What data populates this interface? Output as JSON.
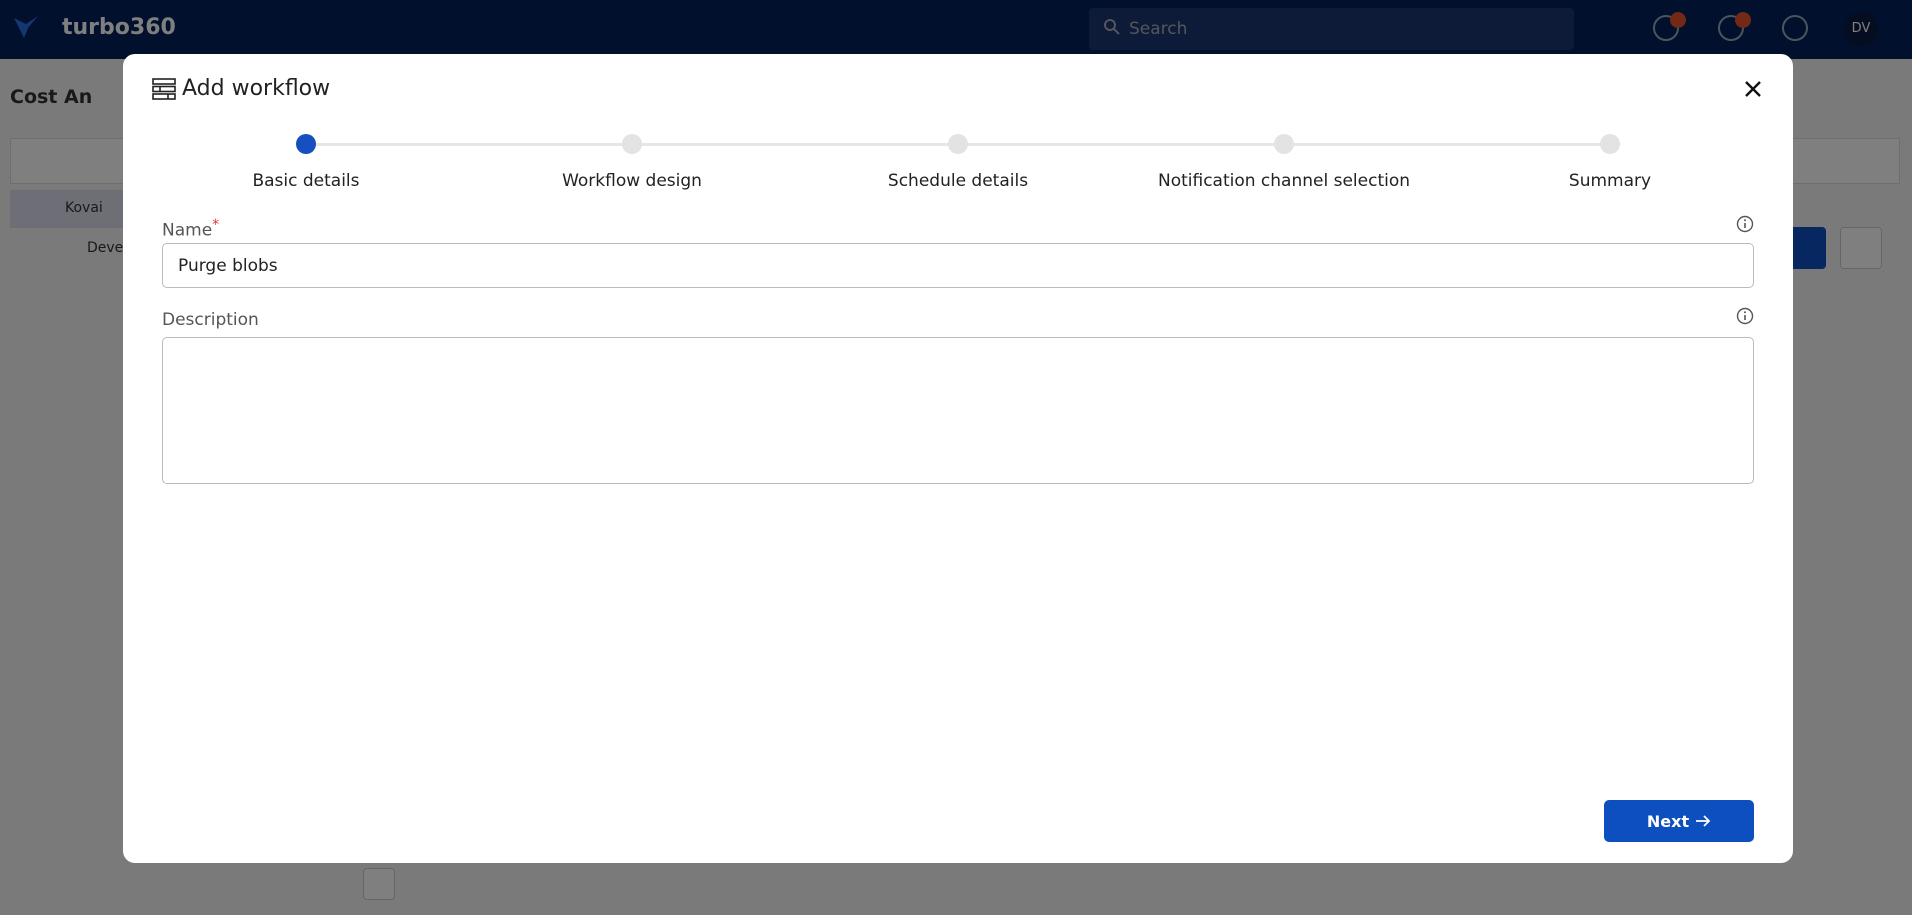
{
  "app": {
    "brand": "turbo360",
    "search_placeholder": "Search",
    "user_initials": "DV"
  },
  "background": {
    "page_title": "Cost An",
    "tree": [
      "Kovai",
      "Deve"
    ]
  },
  "modal": {
    "title": "Add workflow",
    "steps": [
      {
        "label": "Basic details",
        "active": true
      },
      {
        "label": "Workflow design",
        "active": false
      },
      {
        "label": "Schedule details",
        "active": false
      },
      {
        "label": "Notification channel selection",
        "active": false
      },
      {
        "label": "Summary",
        "active": false
      }
    ],
    "name_label": "Name",
    "required_mark": "*",
    "name_value": "Purge blobs",
    "description_label": "Description",
    "description_value": "",
    "next_label": "Next",
    "colors": {
      "primary": "#0d4fbf",
      "active_step": "#1650c0",
      "required": "#e53935"
    }
  }
}
